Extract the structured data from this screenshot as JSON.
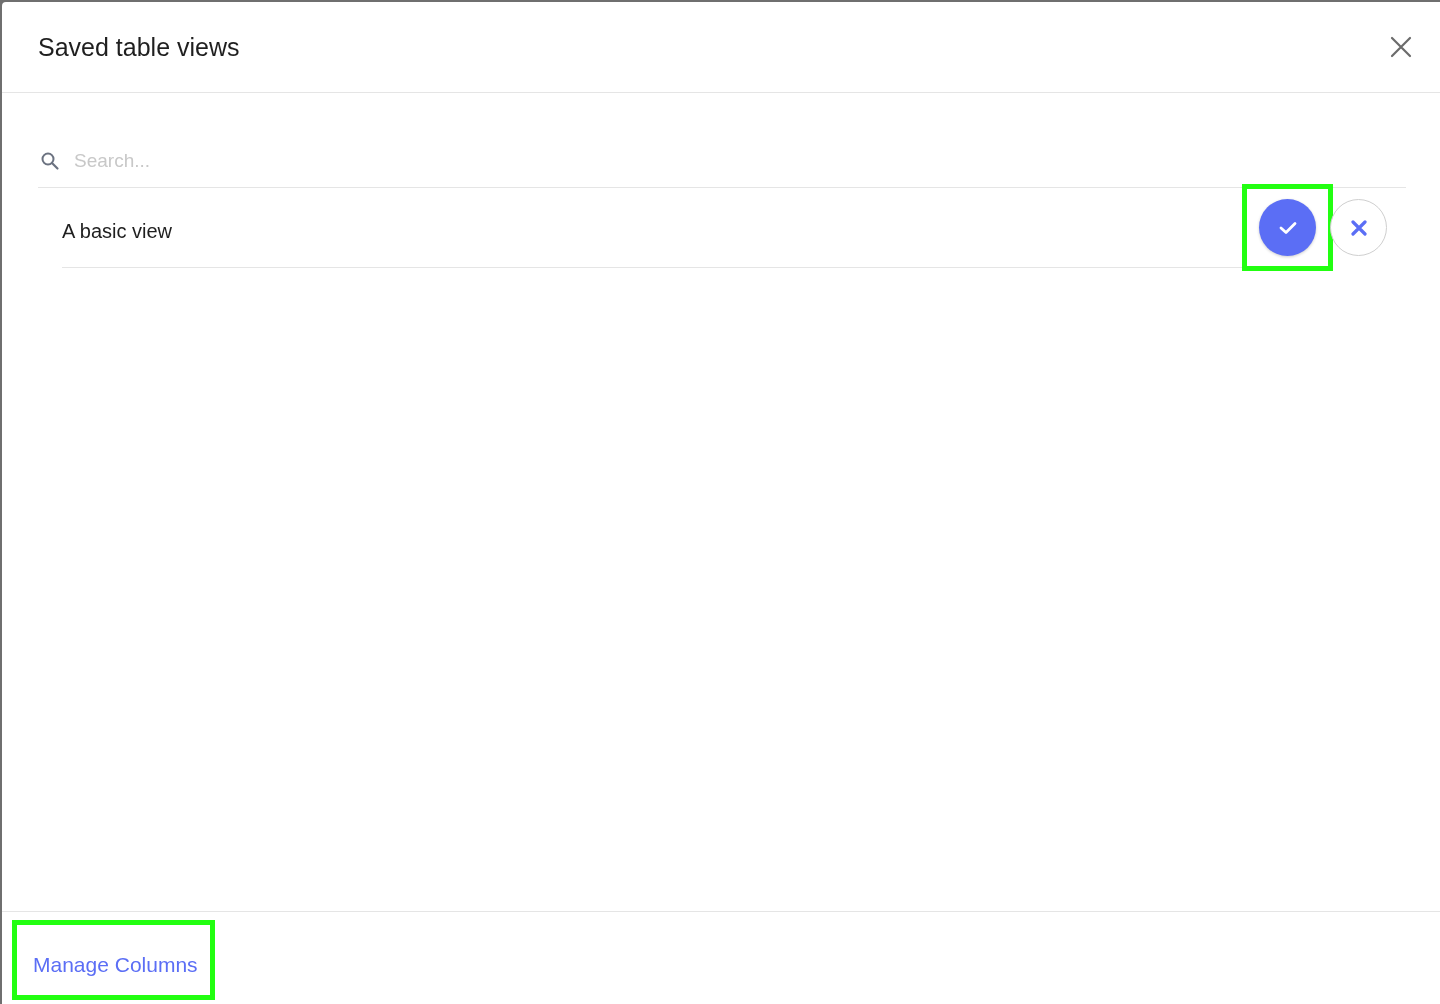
{
  "dialog": {
    "title": "Saved table views"
  },
  "search": {
    "placeholder": "Search..."
  },
  "views": [
    {
      "name": "A basic view",
      "actions": [
        {
          "kind": "apply",
          "highlighted": true
        },
        {
          "kind": "delete",
          "highlighted": false
        }
      ]
    }
  ],
  "footer": {
    "link": "Manage Columns",
    "highlighted": true
  }
}
